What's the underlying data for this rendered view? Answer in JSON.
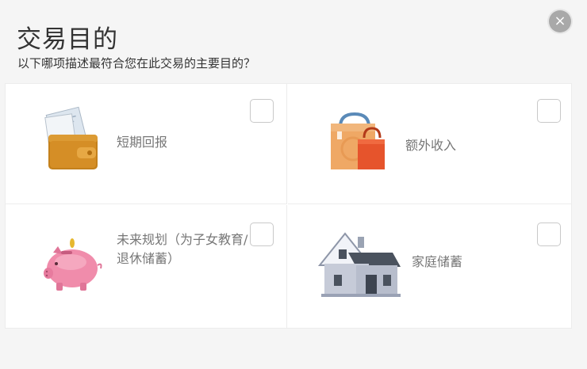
{
  "dialog": {
    "title": "交易目的",
    "subtitle": "以下哪项描述最符合您在此交易的主要目的？",
    "close_label": "×"
  },
  "options": [
    {
      "label": "短期回报",
      "icon": "wallet-icon"
    },
    {
      "label": "额外收入",
      "icon": "shopping-bags-icon"
    },
    {
      "label": "未来规划（为子女教育/退休储蓄）",
      "icon": "piggy-bank-icon"
    },
    {
      "label": "家庭储蓄",
      "icon": "house-icon"
    }
  ]
}
